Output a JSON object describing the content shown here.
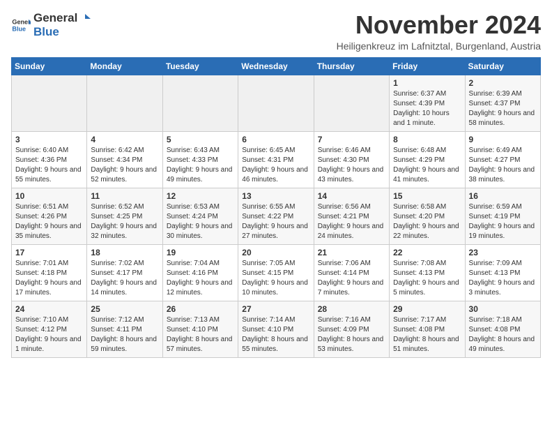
{
  "logo": {
    "text_general": "General",
    "text_blue": "Blue"
  },
  "header": {
    "month_title": "November 2024",
    "subtitle": "Heiligenkreuz im Lafnitztal, Burgenland, Austria"
  },
  "weekdays": [
    "Sunday",
    "Monday",
    "Tuesday",
    "Wednesday",
    "Thursday",
    "Friday",
    "Saturday"
  ],
  "weeks": [
    [
      {
        "day": "",
        "info": ""
      },
      {
        "day": "",
        "info": ""
      },
      {
        "day": "",
        "info": ""
      },
      {
        "day": "",
        "info": ""
      },
      {
        "day": "",
        "info": ""
      },
      {
        "day": "1",
        "info": "Sunrise: 6:37 AM\nSunset: 4:39 PM\nDaylight: 10 hours and 1 minute."
      },
      {
        "day": "2",
        "info": "Sunrise: 6:39 AM\nSunset: 4:37 PM\nDaylight: 9 hours and 58 minutes."
      }
    ],
    [
      {
        "day": "3",
        "info": "Sunrise: 6:40 AM\nSunset: 4:36 PM\nDaylight: 9 hours and 55 minutes."
      },
      {
        "day": "4",
        "info": "Sunrise: 6:42 AM\nSunset: 4:34 PM\nDaylight: 9 hours and 52 minutes."
      },
      {
        "day": "5",
        "info": "Sunrise: 6:43 AM\nSunset: 4:33 PM\nDaylight: 9 hours and 49 minutes."
      },
      {
        "day": "6",
        "info": "Sunrise: 6:45 AM\nSunset: 4:31 PM\nDaylight: 9 hours and 46 minutes."
      },
      {
        "day": "7",
        "info": "Sunrise: 6:46 AM\nSunset: 4:30 PM\nDaylight: 9 hours and 43 minutes."
      },
      {
        "day": "8",
        "info": "Sunrise: 6:48 AM\nSunset: 4:29 PM\nDaylight: 9 hours and 41 minutes."
      },
      {
        "day": "9",
        "info": "Sunrise: 6:49 AM\nSunset: 4:27 PM\nDaylight: 9 hours and 38 minutes."
      }
    ],
    [
      {
        "day": "10",
        "info": "Sunrise: 6:51 AM\nSunset: 4:26 PM\nDaylight: 9 hours and 35 minutes."
      },
      {
        "day": "11",
        "info": "Sunrise: 6:52 AM\nSunset: 4:25 PM\nDaylight: 9 hours and 32 minutes."
      },
      {
        "day": "12",
        "info": "Sunrise: 6:53 AM\nSunset: 4:24 PM\nDaylight: 9 hours and 30 minutes."
      },
      {
        "day": "13",
        "info": "Sunrise: 6:55 AM\nSunset: 4:22 PM\nDaylight: 9 hours and 27 minutes."
      },
      {
        "day": "14",
        "info": "Sunrise: 6:56 AM\nSunset: 4:21 PM\nDaylight: 9 hours and 24 minutes."
      },
      {
        "day": "15",
        "info": "Sunrise: 6:58 AM\nSunset: 4:20 PM\nDaylight: 9 hours and 22 minutes."
      },
      {
        "day": "16",
        "info": "Sunrise: 6:59 AM\nSunset: 4:19 PM\nDaylight: 9 hours and 19 minutes."
      }
    ],
    [
      {
        "day": "17",
        "info": "Sunrise: 7:01 AM\nSunset: 4:18 PM\nDaylight: 9 hours and 17 minutes."
      },
      {
        "day": "18",
        "info": "Sunrise: 7:02 AM\nSunset: 4:17 PM\nDaylight: 9 hours and 14 minutes."
      },
      {
        "day": "19",
        "info": "Sunrise: 7:04 AM\nSunset: 4:16 PM\nDaylight: 9 hours and 12 minutes."
      },
      {
        "day": "20",
        "info": "Sunrise: 7:05 AM\nSunset: 4:15 PM\nDaylight: 9 hours and 10 minutes."
      },
      {
        "day": "21",
        "info": "Sunrise: 7:06 AM\nSunset: 4:14 PM\nDaylight: 9 hours and 7 minutes."
      },
      {
        "day": "22",
        "info": "Sunrise: 7:08 AM\nSunset: 4:13 PM\nDaylight: 9 hours and 5 minutes."
      },
      {
        "day": "23",
        "info": "Sunrise: 7:09 AM\nSunset: 4:13 PM\nDaylight: 9 hours and 3 minutes."
      }
    ],
    [
      {
        "day": "24",
        "info": "Sunrise: 7:10 AM\nSunset: 4:12 PM\nDaylight: 9 hours and 1 minute."
      },
      {
        "day": "25",
        "info": "Sunrise: 7:12 AM\nSunset: 4:11 PM\nDaylight: 8 hours and 59 minutes."
      },
      {
        "day": "26",
        "info": "Sunrise: 7:13 AM\nSunset: 4:10 PM\nDaylight: 8 hours and 57 minutes."
      },
      {
        "day": "27",
        "info": "Sunrise: 7:14 AM\nSunset: 4:10 PM\nDaylight: 8 hours and 55 minutes."
      },
      {
        "day": "28",
        "info": "Sunrise: 7:16 AM\nSunset: 4:09 PM\nDaylight: 8 hours and 53 minutes."
      },
      {
        "day": "29",
        "info": "Sunrise: 7:17 AM\nSunset: 4:08 PM\nDaylight: 8 hours and 51 minutes."
      },
      {
        "day": "30",
        "info": "Sunrise: 7:18 AM\nSunset: 4:08 PM\nDaylight: 8 hours and 49 minutes."
      }
    ]
  ]
}
